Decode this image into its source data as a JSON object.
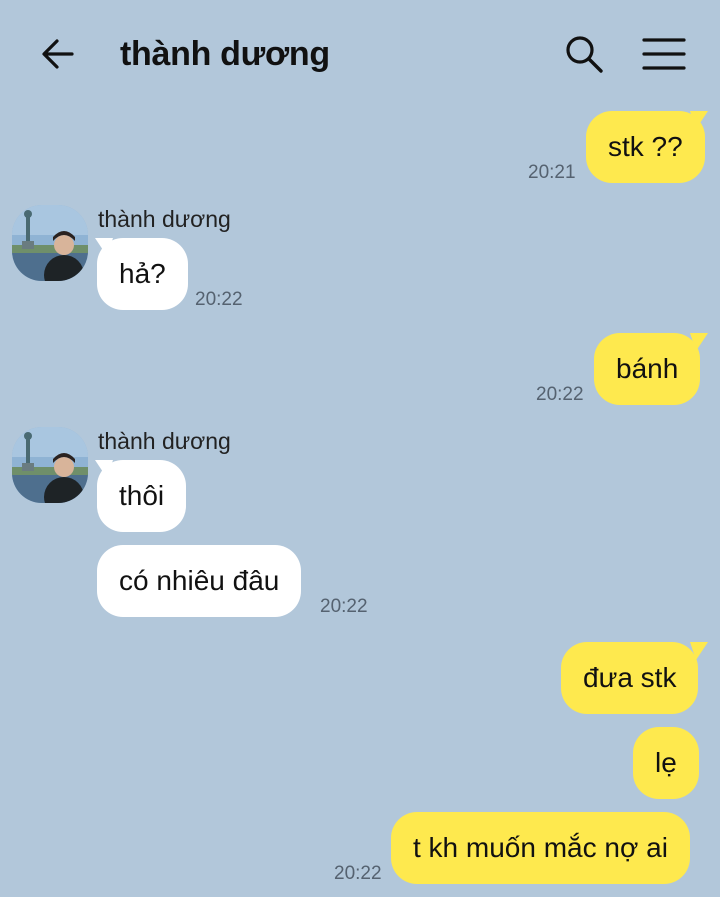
{
  "header": {
    "title": "thành dương",
    "back_icon": "arrow-left-icon",
    "search_icon": "search-icon",
    "menu_icon": "hamburger-menu-icon"
  },
  "colors": {
    "background": "#b2c7da",
    "outgoing_bubble": "#fee94e",
    "incoming_bubble": "#ffffff",
    "time_text": "#556270"
  },
  "messages": {
    "m1": {
      "text": "stk ??",
      "time": "20:21"
    },
    "g1": {
      "sender": "thành dương",
      "m2": "hả?",
      "time": "20:22"
    },
    "m3": {
      "text": "bánh",
      "time": "20:22"
    },
    "g2": {
      "sender": "thành dương",
      "m4": "thôi",
      "m5": "có nhiêu đâu",
      "time": "20:22"
    },
    "m6": {
      "text": "đưa stk"
    },
    "m7": {
      "text": "lẹ"
    },
    "m8": {
      "text": "t kh muốn mắc nợ ai",
      "time": "20:22"
    }
  }
}
